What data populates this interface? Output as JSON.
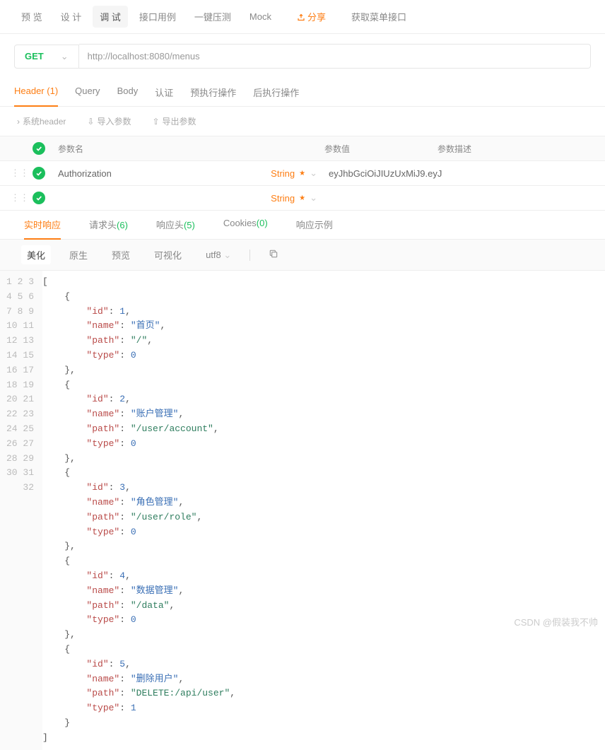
{
  "topTabs": [
    "预 览",
    "设 计",
    "调 试",
    "接口用例",
    "一键压测",
    "Mock"
  ],
  "topActive": 2,
  "share": "分享",
  "getMenu": "获取菜单接口",
  "method": "GET",
  "url": "http://localhost:8080/menus",
  "subTabs": {
    "header": "Header",
    "headerCount": "(1)",
    "query": "Query",
    "body": "Body",
    "auth": "认证",
    "pre": "预执行操作",
    "post": "后执行操作"
  },
  "toolbar": {
    "sys": "系统header",
    "imp": "导入参数",
    "exp": "导出参数"
  },
  "paramHead": {
    "name": "参数名",
    "val": "参数值",
    "desc": "参数描述"
  },
  "rows": [
    {
      "name": "Authorization",
      "type": "String",
      "val": "eyJhbGciOiJIUzUxMiJ9.eyJ"
    },
    {
      "name": "",
      "type": "String",
      "val": ""
    }
  ],
  "respTabs": {
    "realtime": "实时响应",
    "reqHead": "请求头",
    "reqCount": "(6)",
    "respHead": "响应头",
    "respCount": "(5)",
    "cookies": "Cookies",
    "cookiesCount": "(0)",
    "example": "响应示例"
  },
  "respTools": {
    "beautify": "美化",
    "raw": "原生",
    "preview": "预览",
    "visual": "可视化",
    "enc": "utf8"
  },
  "jsonData": [
    {
      "id": 1,
      "name": "首页",
      "path": "/",
      "type": 0
    },
    {
      "id": 2,
      "name": "账户管理",
      "path": "/user/account",
      "type": 0
    },
    {
      "id": 3,
      "name": "角色管理",
      "path": "/user/role",
      "type": 0
    },
    {
      "id": 4,
      "name": "数据管理",
      "path": "/data",
      "type": 0
    },
    {
      "id": 5,
      "name": "删除用户",
      "path": "DELETE:/api/user",
      "type": 1
    }
  ],
  "watermark": "CSDN @假装我不帅"
}
